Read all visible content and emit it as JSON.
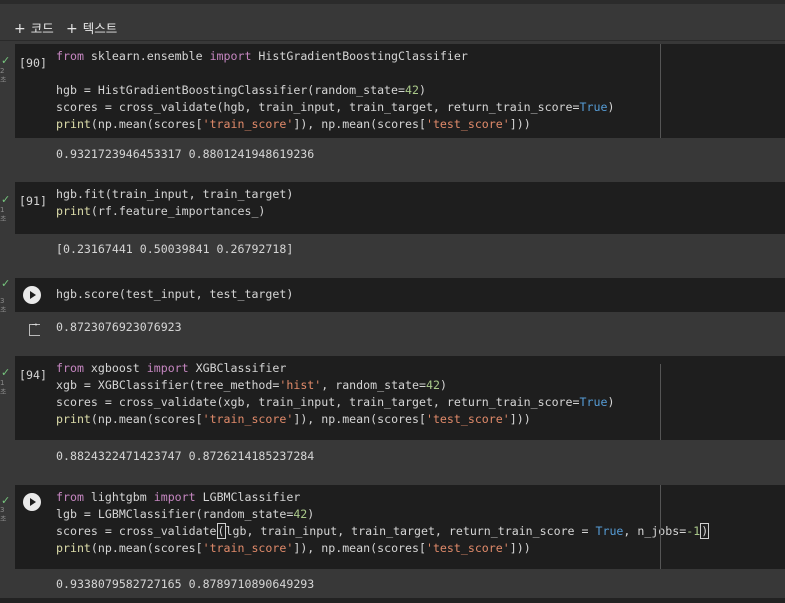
{
  "toolbar": {
    "add_code": "코드",
    "add_text": "텍스트"
  },
  "cells": [
    {
      "exec_label": "[90]",
      "status": "check",
      "duration": "2초",
      "output": "0.9321723946453317 0.8801241948619236"
    },
    {
      "exec_label": "[91]",
      "status": "check",
      "duration": "1초",
      "output": "[0.23167441 0.50039841 0.26792718]"
    },
    {
      "exec_label": "",
      "status": "run",
      "duration": "3초",
      "output": "0.8723076923076923"
    },
    {
      "exec_label": "[94]",
      "status": "check",
      "duration": "1초",
      "output": "0.8824322471423747 0.8726214185237284"
    },
    {
      "exec_label": "",
      "status": "run",
      "duration": "3초",
      "output": "0.9338079582727165 0.8789710890649293"
    }
  ],
  "colors": {
    "background": "#383838",
    "cell_background": "#1e1e1e",
    "keyword": "#c586c0",
    "string": "#e08a6a",
    "number": "#aac98a",
    "boolean": "#569cd6",
    "function": "#dcdcaa",
    "check": "#76c57d"
  }
}
